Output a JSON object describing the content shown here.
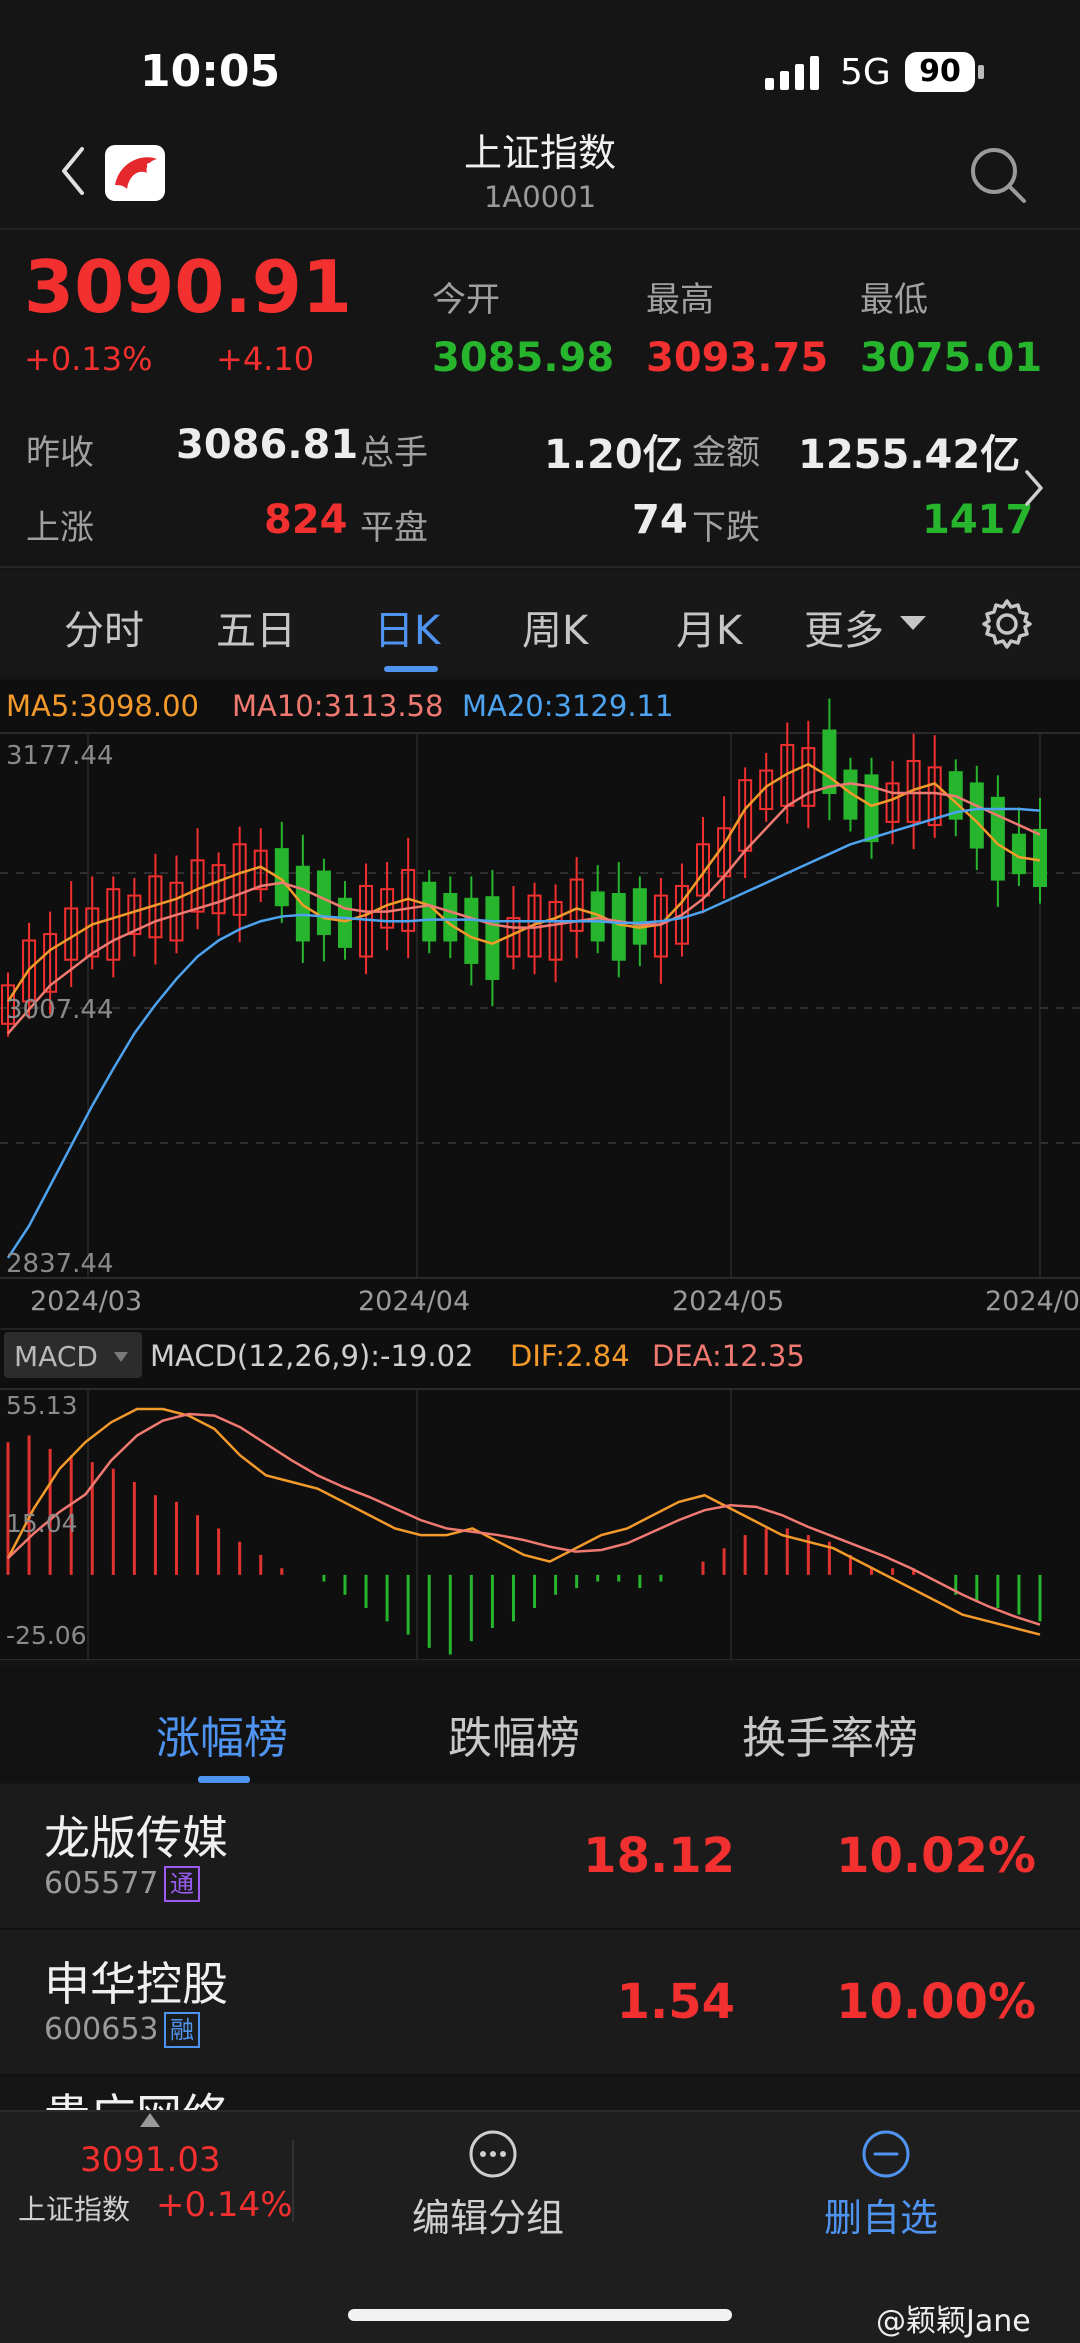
{
  "status_bar": {
    "time": "10:05",
    "network": "5G",
    "battery": "90"
  },
  "header": {
    "title": "上证指数",
    "code": "1A0001"
  },
  "quote": {
    "price": "3090.91",
    "change_pct": "+0.13%",
    "change_value": "+4.10",
    "open_label": "今开",
    "open": "3085.98",
    "high_label": "最高",
    "high": "3093.75",
    "low_label": "最低",
    "low": "3075.01",
    "prev_close_label": "昨收",
    "prev_close": "3086.81",
    "volume_label": "总手",
    "volume": "1.20亿",
    "amount_label": "金额",
    "amount": "1255.42亿",
    "up_label": "上涨",
    "up_count": "824",
    "flat_label": "平盘",
    "flat_count": "74",
    "down_label": "下跌",
    "down_count": "1417"
  },
  "period_tabs": [
    {
      "label": "分时"
    },
    {
      "label": "五日"
    },
    {
      "label": "日K"
    },
    {
      "label": "周K"
    },
    {
      "label": "月K"
    },
    {
      "label": "更多"
    }
  ],
  "active_period": "日K",
  "chart_data": [
    {
      "type": "line",
      "title": "",
      "legend": [
        {
          "text": "MA5:3098.00",
          "color": "#f39a2b"
        },
        {
          "text": "MA10:3113.58",
          "color": "#f07a72"
        },
        {
          "text": "MA20:3129.11",
          "color": "#4ea3f0"
        }
      ],
      "y_ticks": [
        "3177.44",
        "3007.44",
        "2837.44"
      ],
      "ylim": [
        2837.44,
        3177.44
      ],
      "x_ticks": [
        "2024/03",
        "2024/04",
        "2024/05",
        "2024/0"
      ],
      "grid": true,
      "series": [
        {
          "name": "MA5",
          "color": "#f39a2b",
          "values": [
            3010,
            3030,
            3042,
            3050,
            3058,
            3062,
            3066,
            3070,
            3074,
            3080,
            3085,
            3090,
            3094,
            3086,
            3070,
            3062,
            3060,
            3064,
            3070,
            3074,
            3070,
            3058,
            3050,
            3046,
            3052,
            3058,
            3062,
            3068,
            3064,
            3058,
            3056,
            3058,
            3072,
            3090,
            3108,
            3130,
            3144,
            3152,
            3158,
            3150,
            3140,
            3132,
            3136,
            3142,
            3146,
            3134,
            3122,
            3108,
            3100,
            3098
          ]
        },
        {
          "name": "MA10",
          "color": "#f07a72",
          "values": [
            2990,
            3005,
            3020,
            3030,
            3040,
            3048,
            3054,
            3060,
            3064,
            3068,
            3072,
            3077,
            3082,
            3084,
            3080,
            3074,
            3068,
            3066,
            3066,
            3068,
            3070,
            3066,
            3062,
            3058,
            3056,
            3056,
            3058,
            3060,
            3062,
            3060,
            3058,
            3058,
            3064,
            3074,
            3088,
            3104,
            3118,
            3132,
            3140,
            3144,
            3146,
            3144,
            3140,
            3140,
            3140,
            3138,
            3132,
            3126,
            3120,
            3114
          ]
        },
        {
          "name": "MA20",
          "color": "#4ea3f0",
          "values": [
            2850,
            2870,
            2895,
            2920,
            2945,
            2968,
            2990,
            3008,
            3024,
            3038,
            3048,
            3055,
            3060,
            3063,
            3064,
            3063,
            3062,
            3061,
            3060,
            3060,
            3061,
            3061,
            3061,
            3060,
            3060,
            3060,
            3060,
            3060,
            3060,
            3059,
            3059,
            3060,
            3062,
            3066,
            3072,
            3078,
            3084,
            3090,
            3096,
            3102,
            3108,
            3112,
            3116,
            3120,
            3124,
            3128,
            3130,
            3130,
            3130,
            3129
          ]
        }
      ]
    },
    {
      "type": "bar",
      "title": "",
      "label": "MACD",
      "params": "MACD(12,26,9):-19.02",
      "dif": "DIF:2.84",
      "dea": "DEA:12.35",
      "y_ticks": [
        "55.13",
        "15.04",
        "-25.06"
      ],
      "ylim": [
        -25.06,
        55.13
      ],
      "histogram": [
        40,
        42,
        38,
        36,
        34,
        32,
        28,
        24,
        22,
        18,
        14,
        10,
        6,
        2,
        0,
        -2,
        -6,
        -10,
        -14,
        -18,
        -22,
        -24,
        -20,
        -16,
        -14,
        -10,
        -6,
        -4,
        -2,
        -2,
        -4,
        -2,
        0,
        4,
        8,
        12,
        14,
        14,
        12,
        10,
        6,
        2,
        2,
        2,
        0,
        -6,
        -8,
        -10,
        -12,
        -14
      ],
      "dif_values": [
        5,
        20,
        32,
        40,
        46,
        50,
        50,
        48,
        44,
        36,
        30,
        28,
        26,
        22,
        18,
        14,
        12,
        12,
        14,
        10,
        6,
        4,
        8,
        12,
        14,
        18,
        22,
        24,
        20,
        16,
        12,
        10,
        8,
        4,
        0,
        -4,
        -8,
        -12,
        -14,
        -16,
        -18
      ]
    }
  ],
  "leaderboard": {
    "tabs": [
      {
        "label": "涨幅榜"
      },
      {
        "label": "跌幅榜"
      },
      {
        "label": "换手率榜"
      }
    ],
    "rows": [
      {
        "name": "龙版传媒",
        "code": "605577",
        "tag": "通",
        "tag_color": "#9a5cf0",
        "price": "18.12",
        "pct": "10.02%"
      },
      {
        "name": "申华控股",
        "code": "600653",
        "tag": "融",
        "tag_color": "#4f94f0",
        "price": "1.54",
        "pct": "10.00%"
      }
    ],
    "peek_name": "贵广网络"
  },
  "bottom_bar": {
    "mini_price": "3091.03",
    "mini_name": "上证指数",
    "mini_pct": "+0.14%",
    "edit_label": "编辑分组",
    "remove_label": "删自选"
  },
  "watermark": "@颖颖Jane"
}
